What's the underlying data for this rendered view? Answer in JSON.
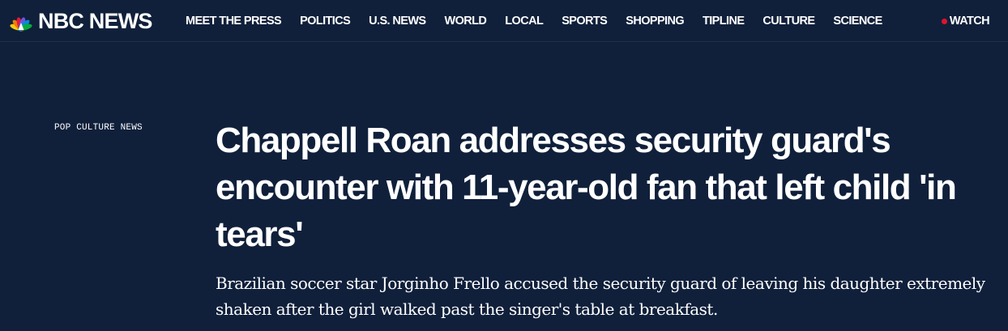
{
  "site": {
    "logo_text": "NBC NEWS",
    "logo_icon": "peacock-icon",
    "peacock_colors": [
      "#fccc12",
      "#ef7c0a",
      "#e6183a",
      "#6e55dc",
      "#068ad9",
      "#05ac3f"
    ]
  },
  "nav": {
    "items": [
      {
        "label": "MEET THE PRESS"
      },
      {
        "label": "POLITICS"
      },
      {
        "label": "U.S. NEWS"
      },
      {
        "label": "WORLD"
      },
      {
        "label": "LOCAL"
      },
      {
        "label": "SPORTS"
      },
      {
        "label": "SHOPPING"
      },
      {
        "label": "TIPLINE"
      },
      {
        "label": "CULTURE"
      },
      {
        "label": "SCIENCE"
      }
    ],
    "watch_label": "WATCH",
    "watch_dot_color": "#e0142d"
  },
  "article": {
    "category": "POP CULTURE NEWS",
    "headline": "Chappell Roan addresses security guard's encounter with 11-year-old fan that left child 'in tears'",
    "dek": "Brazilian soccer star Jorginho Frello accused the security guard of leaving his daughter extremely shaken after the girl walked past the singer's table at breakfast."
  },
  "theme": {
    "background": "#10203b",
    "text": "#ffffff"
  }
}
